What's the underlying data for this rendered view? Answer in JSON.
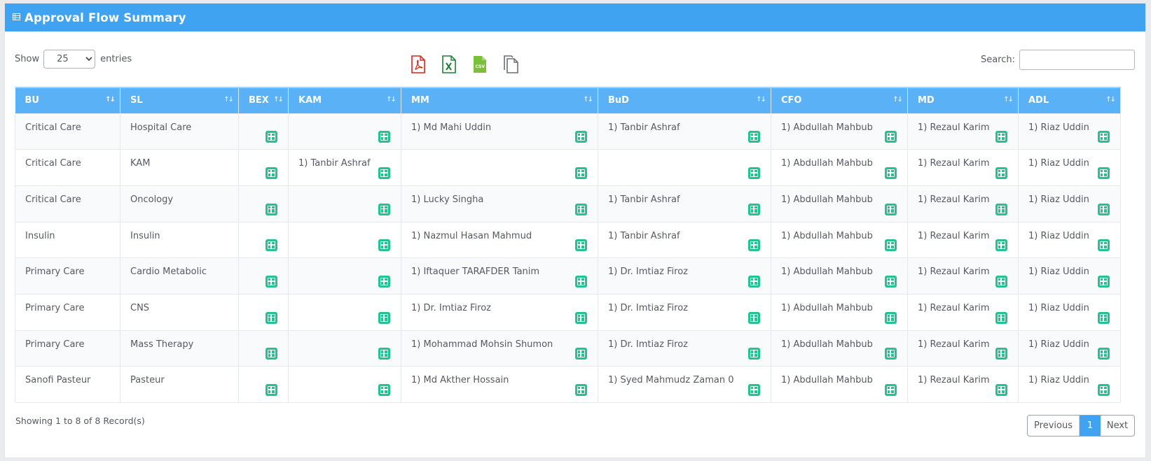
{
  "header": {
    "title": "Approval Flow Summary",
    "icon": "table-icon"
  },
  "length": {
    "show_label": "Show",
    "value": "25",
    "entries_label": "entries"
  },
  "exports": [
    {
      "name": "pdf-export-icon",
      "color": "#d9241c"
    },
    {
      "name": "excel-export-icon",
      "color": "#1e7e34"
    },
    {
      "name": "csv-export-icon",
      "color": "#7bbf3a"
    },
    {
      "name": "copy-export-icon",
      "color": "#6b6e75"
    }
  ],
  "search": {
    "label": "Search:",
    "value": ""
  },
  "table": {
    "columns": [
      "BU",
      "SL",
      "BEX",
      "KAM",
      "MM",
      "BuD",
      "CFO",
      "MD",
      "ADL"
    ],
    "rows": [
      [
        "Critical Care",
        "Hospital Care",
        "",
        "",
        "1) Md Mahi Uddin",
        "1) Tanbir Ashraf",
        "1) Abdullah Mahbub",
        "1) Rezaul Karim",
        "1) Riaz Uddin"
      ],
      [
        "Critical Care",
        "KAM",
        "",
        "1) Tanbir Ashraf",
        "",
        "",
        "1) Abdullah Mahbub",
        "1) Rezaul Karim",
        "1) Riaz Uddin"
      ],
      [
        "Critical Care",
        "Oncology",
        "",
        "",
        "1) Lucky Singha",
        "1) Tanbir Ashraf",
        "1) Abdullah Mahbub",
        "1) Rezaul Karim",
        "1) Riaz Uddin"
      ],
      [
        "Insulin",
        "Insulin",
        "",
        "",
        "1) Nazmul Hasan Mahmud",
        "1) Tanbir Ashraf",
        "1) Abdullah Mahbub",
        "1) Rezaul Karim",
        "1) Riaz Uddin"
      ],
      [
        "Primary Care",
        "Cardio Metabolic",
        "",
        "",
        "1) Iftaquer TARAFDER Tanim",
        "1) Dr. Imtiaz Firoz",
        "1) Abdullah Mahbub",
        "1) Rezaul Karim",
        "1) Riaz Uddin"
      ],
      [
        "Primary Care",
        "CNS",
        "",
        "",
        "1) Dr. Imtiaz Firoz",
        "1) Dr. Imtiaz Firoz",
        "1) Abdullah Mahbub",
        "1) Rezaul Karim",
        "1) Riaz Uddin"
      ],
      [
        "Primary Care",
        "Mass Therapy",
        "",
        "",
        "1) Mohammad Mohsin Shumon",
        "1) Dr. Imtiaz Firoz",
        "1) Abdullah Mahbub",
        "1) Rezaul Karim",
        "1) Riaz Uddin"
      ],
      [
        "Sanofi Pasteur",
        "Pasteur",
        "",
        "",
        "1) Md Akther Hossain",
        "1) Syed Mahmudz Zaman 0",
        "1) Abdullah Mahbub",
        "1) Rezaul Karim",
        "1) Riaz Uddin"
      ]
    ]
  },
  "footer": {
    "info": "Showing 1 to 8 of 8 Record(s)",
    "previous": "Previous",
    "current_page": "1",
    "next": "Next"
  },
  "colors": {
    "header": "#3fa3f2",
    "table_header": "#5ab1f5",
    "add_button": "#22c38e"
  }
}
